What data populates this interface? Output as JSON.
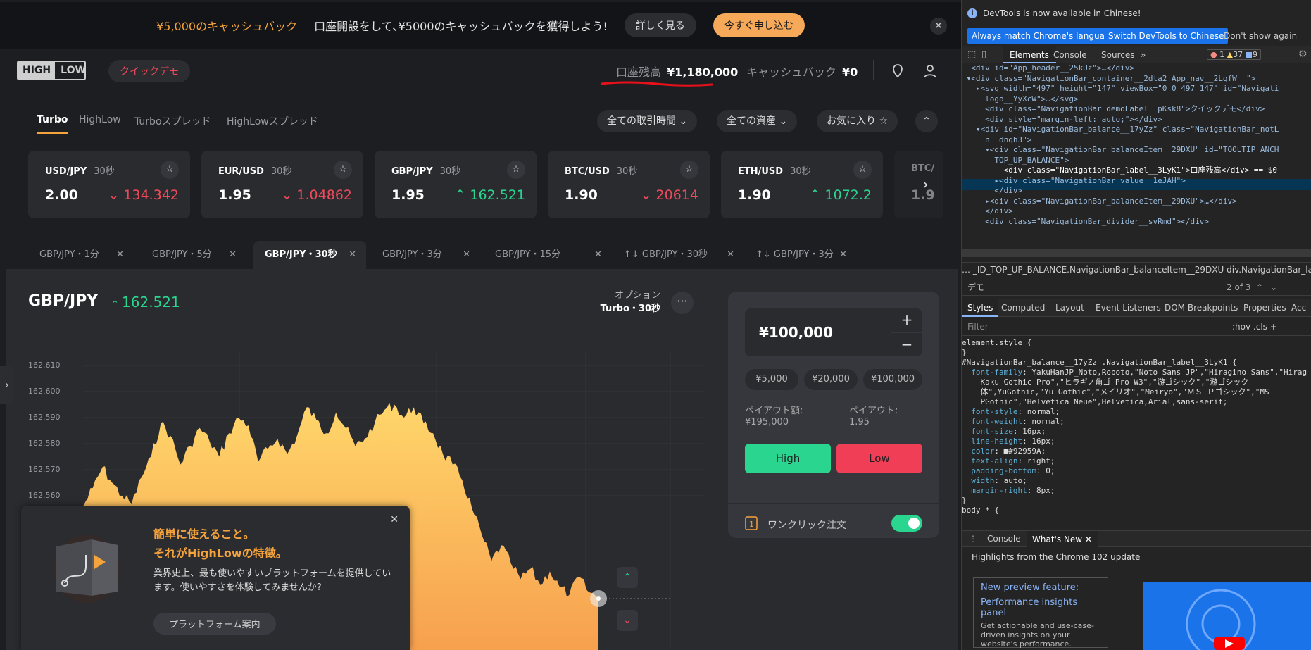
{
  "promo": {
    "title": "¥5,000のキャッシュバック",
    "text": "口座開設をして､¥5000のキャッシュバックを獲得しよう!",
    "details_label": "詳しく見る",
    "apply_label": "今すぐ申し込む",
    "close": "✕"
  },
  "nav": {
    "logo_left": "HIGH",
    "logo_right": "LOW",
    "demo_label": "クイックデモ",
    "balance_label": "口座残高",
    "balance_value": "¥1,180,000",
    "cashback_label": "キャッシュバック",
    "cashback_value": "¥0"
  },
  "subnav": {
    "tabs": [
      "Turbo",
      "HighLow",
      "Turboスプレッド",
      "HighLowスプレッド"
    ],
    "filters": [
      "全ての取引時間",
      "全ての資産",
      "お気に入り"
    ]
  },
  "cards": [
    {
      "symbol": "USD/JPY",
      "duration": "30秒",
      "payout": "2.00",
      "rate": "134.342",
      "dir": "down"
    },
    {
      "symbol": "EUR/USD",
      "duration": "30秒",
      "payout": "1.95",
      "rate": "1.04862",
      "dir": "down"
    },
    {
      "symbol": "GBP/JPY",
      "duration": "30秒",
      "payout": "1.95",
      "rate": "162.521",
      "dir": "up"
    },
    {
      "symbol": "BTC/USD",
      "duration": "30秒",
      "payout": "1.90",
      "rate": "20614",
      "dir": "down"
    },
    {
      "symbol": "ETH/USD",
      "duration": "30秒",
      "payout": "1.90",
      "rate": "1072.2",
      "dir": "up"
    },
    {
      "symbol": "BTC/",
      "duration": "",
      "payout": "1.9",
      "rate": "",
      "dir": ""
    }
  ],
  "chart_tabs": [
    "GBP/JPY・1分",
    "GBP/JPY・5分",
    "GBP/JPY・30秒",
    "GBP/JPY・3分",
    "GBP/JPY・15分",
    "↑↓ GBP/JPY・30秒",
    "↑↓ GBP/JPY・3分"
  ],
  "chart": {
    "symbol": "GBP/JPY",
    "rate": "162.521",
    "option_label": "オプション",
    "option_value": "Turbo・30秒",
    "yticks": [
      "162.610",
      "162.600",
      "162.590",
      "162.580",
      "162.570",
      "162.560"
    ]
  },
  "chart_data": {
    "type": "area",
    "title": "",
    "xlabel": "",
    "ylabel": "",
    "ylim": [
      162.52,
      162.615
    ],
    "series": [
      {
        "values": [
          162.556,
          162.563,
          162.571,
          162.565,
          162.56,
          162.557,
          162.567,
          162.575,
          162.588,
          162.583,
          162.572,
          162.579,
          162.586,
          162.581,
          162.575,
          162.584,
          162.59,
          162.587,
          162.573,
          162.578,
          162.582,
          162.576,
          162.583,
          162.594,
          162.589,
          162.584,
          162.592,
          162.586,
          162.579,
          162.582,
          162.588,
          162.593,
          162.595,
          162.59,
          162.594,
          162.588,
          162.584,
          162.576,
          162.572,
          162.566,
          162.555,
          162.545,
          162.535,
          162.541,
          162.534,
          162.528,
          162.532,
          162.526,
          162.531,
          162.525,
          162.522,
          162.529,
          162.523,
          162.521
        ]
      }
    ]
  },
  "trade": {
    "amount": "¥100,000",
    "plus": "+",
    "minus": "−",
    "quick": [
      "¥5,000",
      "¥20,000",
      "¥100,000"
    ],
    "payout_amount_label": "ペイアウト額:",
    "payout_amount_value": "¥195,000",
    "payout_label": "ペイアウト:",
    "payout_value": "1.95",
    "high": "High",
    "low": "Low",
    "oneclick": "ワンクリック注文"
  },
  "popup": {
    "heading1": "簡単に使えること。",
    "heading2": "それがHighLowの特徴。",
    "body": "業界史上、最も使いやすいプラットフォームを提供しています。使いやすさを体験してみませんか?",
    "guide": "プラットフォーム案内",
    "close": "✕"
  },
  "devtools": {
    "info": "DevTools is now available in Chinese!",
    "btn_match": "Always match Chrome's language",
    "btn_switch": "Switch DevTools to Chinese",
    "btn_dont": "Don't show again",
    "tabs": [
      "Elements",
      "Console",
      "Sources",
      "»"
    ],
    "counts": [
      "1",
      "37",
      "9"
    ],
    "dom_lines": [
      "  <div id=\"App_header__25kUz\">…</div>",
      " ▾<div class=\"NavigationBar_container__2dta2 App_nav__2LqfW  \">",
      "   ▸<svg width=\"497\" height=\"147\" viewBox=\"0 0 497 147\" id=\"Navigati",
      "     logo__YyXcW\">…</svg>",
      "     <div class=\"NavigationBar_demoLabel__pKsk8\">クイックデモ</div>",
      "     <div style=\"margin-left: auto;\"></div>",
      "   ▾<div id=\"NavigationBar_balance__17yZz\" class=\"NavigationBar_notL",
      "     n__dnqh3\">",
      "     ▾<div class=\"NavigationBar_balanceItem__29DXU\" id=\"TOOLTIP_ANCH",
      "       TOP_UP_BALANCE\">",
      "         <div class=\"NavigationBar_label__3LyK1\">口座残高</div> == $0",
      "       ▸<div class=\"NavigationBar_value__1eJAH\">",
      "       </div>",
      "     ▸<div class=\"NavigationBar_balanceItem__29DXU\">…</div>",
      "     </div>",
      "     <div class=\"NavigationBar_divider__svRmd\"></div>"
    ],
    "breadcrumb": "… _ID_TOP_UP_BALANCE.NavigationBar_balanceItem__29DXU   div.NavigationBar_label__3l",
    "search_value": "デモ",
    "search_count": "2 of 3",
    "style_tabs": [
      "Styles",
      "Computed",
      "Layout",
      "Event Listeners",
      "DOM Breakpoints",
      "Properties",
      "Acc"
    ],
    "filter_placeholder": "Filter",
    "filter_right": ":hov  .cls  +",
    "css_lines": [
      "element.style {",
      "}",
      "#NavigationBar_balance__17yZz .NavigationBar_label__3LyK1 {",
      "  font-family: YakuHanJP_Noto,Roboto,\"Noto Sans JP\",\"Hiragino Sans\",\"Hirag",
      "    Kaku Gothic Pro\",\"ヒラギノ角ゴ Pro W3\",\"游ゴシック\",\"游ゴシック",
      "    体\",YuGothic,\"Yu Gothic\",\"メイリオ\",\"Meiryo\",\"ＭＳ Ｐゴシック\",\"MS",
      "    PGothic\",\"Helvetica Neue\",Helvetica,Arial,sans-serif;",
      "  font-style: normal;",
      "  font-weight: normal;",
      "  font-size: 16px;",
      "  line-height: 16px;",
      "  color: ■#92959A;",
      "  text-align: right;",
      "  padding-bottom: 0;",
      "  width: auto;",
      "  margin-right: 8px;",
      "}",
      "body * {"
    ],
    "drawer_tabs": [
      "Console",
      "What's New"
    ],
    "highlights": "Highlights from the Chrome 102 update",
    "preview_feature": "New preview feature:",
    "perf_panel": "Performance insights panel",
    "perf_desc": "Get actionable and use-case-driven insights on your website's performance."
  }
}
